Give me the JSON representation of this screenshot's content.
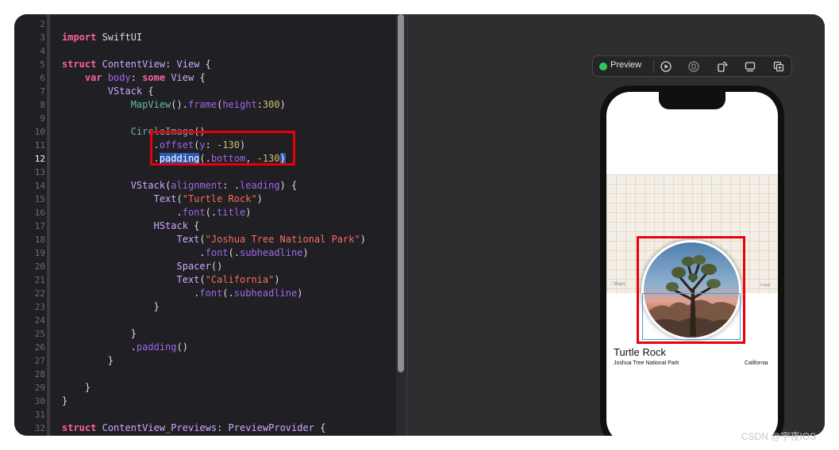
{
  "editor": {
    "current_line": 12,
    "lines": [
      {
        "n": "2",
        "tokens": []
      },
      {
        "n": "3",
        "tokens": [
          {
            "t": "import",
            "c": "kw"
          },
          {
            "t": " SwiftUI",
            "c": ""
          }
        ]
      },
      {
        "n": "4",
        "tokens": []
      },
      {
        "n": "5",
        "tokens": [
          {
            "t": "struct",
            "c": "kw"
          },
          {
            "t": " ",
            "c": ""
          },
          {
            "t": "ContentView",
            "c": "ty"
          },
          {
            "t": ": ",
            "c": ""
          },
          {
            "t": "View",
            "c": "ty"
          },
          {
            "t": " {",
            "c": ""
          }
        ]
      },
      {
        "n": "6",
        "tokens": [
          {
            "t": "    ",
            "c": ""
          },
          {
            "t": "var",
            "c": "kw"
          },
          {
            "t": " ",
            "c": ""
          },
          {
            "t": "body",
            "c": "prop"
          },
          {
            "t": ": ",
            "c": ""
          },
          {
            "t": "some",
            "c": "kw"
          },
          {
            "t": " ",
            "c": ""
          },
          {
            "t": "View",
            "c": "ty"
          },
          {
            "t": " {",
            "c": ""
          }
        ]
      },
      {
        "n": "7",
        "tokens": [
          {
            "t": "        ",
            "c": ""
          },
          {
            "t": "VStack",
            "c": "ty"
          },
          {
            "t": " {",
            "c": ""
          }
        ]
      },
      {
        "n": "8",
        "tokens": [
          {
            "t": "            ",
            "c": ""
          },
          {
            "t": "MapView",
            "c": "fn"
          },
          {
            "t": "().",
            "c": ""
          },
          {
            "t": "frame",
            "c": "prop"
          },
          {
            "t": "(",
            "c": ""
          },
          {
            "t": "height",
            "c": "prop"
          },
          {
            "t": ":",
            "c": ""
          },
          {
            "t": "300",
            "c": "num"
          },
          {
            "t": ")",
            "c": ""
          }
        ]
      },
      {
        "n": "9",
        "tokens": []
      },
      {
        "n": "10",
        "tokens": [
          {
            "t": "            ",
            "c": ""
          },
          {
            "t": "CircleImage",
            "c": "fn"
          },
          {
            "t": "()",
            "c": ""
          }
        ]
      },
      {
        "n": "11",
        "tokens": [
          {
            "t": "                .",
            "c": ""
          },
          {
            "t": "offset",
            "c": "prop"
          },
          {
            "t": "(",
            "c": ""
          },
          {
            "t": "y",
            "c": "prop"
          },
          {
            "t": ": ",
            "c": ""
          },
          {
            "t": "-130",
            "c": "num"
          },
          {
            "t": ")",
            "c": ""
          }
        ]
      },
      {
        "n": "12",
        "tokens": [
          {
            "t": "                .",
            "c": ""
          },
          {
            "t": "padding",
            "c": "sel"
          },
          {
            "t": "(.",
            "c": "underline"
          },
          {
            "t": "bottom",
            "c": "prop underline"
          },
          {
            "t": ", ",
            "c": "underline"
          },
          {
            "t": "-130",
            "c": "num underline"
          },
          {
            "t": ")",
            "c": "sel"
          }
        ]
      },
      {
        "n": "13",
        "tokens": []
      },
      {
        "n": "14",
        "tokens": [
          {
            "t": "            ",
            "c": ""
          },
          {
            "t": "VStack",
            "c": "ty"
          },
          {
            "t": "(",
            "c": ""
          },
          {
            "t": "alignment",
            "c": "prop"
          },
          {
            "t": ": .",
            "c": ""
          },
          {
            "t": "leading",
            "c": "prop"
          },
          {
            "t": ") {",
            "c": ""
          }
        ]
      },
      {
        "n": "15",
        "tokens": [
          {
            "t": "                ",
            "c": ""
          },
          {
            "t": "Text",
            "c": "ty"
          },
          {
            "t": "(",
            "c": ""
          },
          {
            "t": "\"Turtle Rock\"",
            "c": "str"
          },
          {
            "t": ")",
            "c": ""
          }
        ]
      },
      {
        "n": "16",
        "tokens": [
          {
            "t": "                    .",
            "c": ""
          },
          {
            "t": "font",
            "c": "prop"
          },
          {
            "t": "(.",
            "c": ""
          },
          {
            "t": "title",
            "c": "prop"
          },
          {
            "t": ")",
            "c": ""
          }
        ]
      },
      {
        "n": "17",
        "tokens": [
          {
            "t": "                ",
            "c": ""
          },
          {
            "t": "HStack",
            "c": "ty"
          },
          {
            "t": " {",
            "c": ""
          }
        ]
      },
      {
        "n": "18",
        "tokens": [
          {
            "t": "                    ",
            "c": ""
          },
          {
            "t": "Text",
            "c": "ty"
          },
          {
            "t": "(",
            "c": ""
          },
          {
            "t": "\"Joshua Tree National Park\"",
            "c": "str"
          },
          {
            "t": ")",
            "c": ""
          }
        ]
      },
      {
        "n": "19",
        "tokens": [
          {
            "t": "                        .",
            "c": ""
          },
          {
            "t": "font",
            "c": "prop"
          },
          {
            "t": "(.",
            "c": ""
          },
          {
            "t": "subheadline",
            "c": "prop"
          },
          {
            "t": ")",
            "c": ""
          }
        ]
      },
      {
        "n": "20",
        "tokens": [
          {
            "t": "                    ",
            "c": ""
          },
          {
            "t": "Spacer",
            "c": "ty"
          },
          {
            "t": "()",
            "c": ""
          }
        ]
      },
      {
        "n": "21",
        "tokens": [
          {
            "t": "                    ",
            "c": ""
          },
          {
            "t": "Text",
            "c": "ty"
          },
          {
            "t": "(",
            "c": ""
          },
          {
            "t": "\"California\"",
            "c": "str"
          },
          {
            "t": ")",
            "c": ""
          }
        ]
      },
      {
        "n": "22",
        "tokens": [
          {
            "t": "                       .",
            "c": ""
          },
          {
            "t": "font",
            "c": "prop"
          },
          {
            "t": "(.",
            "c": ""
          },
          {
            "t": "subheadline",
            "c": "prop"
          },
          {
            "t": ")",
            "c": ""
          }
        ]
      },
      {
        "n": "23",
        "tokens": [
          {
            "t": "                ",
            "c": ""
          },
          {
            "t": "}",
            "c": ""
          }
        ]
      },
      {
        "n": "24",
        "tokens": []
      },
      {
        "n": "25",
        "tokens": [
          {
            "t": "            ",
            "c": ""
          },
          {
            "t": "}",
            "c": ""
          }
        ]
      },
      {
        "n": "26",
        "tokens": [
          {
            "t": "            .",
            "c": ""
          },
          {
            "t": "padding",
            "c": "prop"
          },
          {
            "t": "()",
            "c": ""
          }
        ]
      },
      {
        "n": "27",
        "tokens": [
          {
            "t": "        ",
            "c": ""
          },
          {
            "t": "}",
            "c": ""
          }
        ]
      },
      {
        "n": "28",
        "tokens": []
      },
      {
        "n": "29",
        "tokens": [
          {
            "t": "    ",
            "c": ""
          },
          {
            "t": "}",
            "c": ""
          }
        ]
      },
      {
        "n": "30",
        "tokens": [
          {
            "t": "}",
            "c": ""
          }
        ]
      },
      {
        "n": "31",
        "tokens": []
      },
      {
        "n": "32",
        "tokens": [
          {
            "t": "struct",
            "c": "kw"
          },
          {
            "t": " ",
            "c": ""
          },
          {
            "t": "ContentView_Previews",
            "c": "ty"
          },
          {
            "t": ": ",
            "c": ""
          },
          {
            "t": "PreviewProvider",
            "c": "ty"
          },
          {
            "t": " {",
            "c": ""
          }
        ]
      }
    ]
  },
  "preview_bar": {
    "label": "Preview",
    "status_color": "#31c75a",
    "icons": [
      "live-play-icon",
      "selectable-icon",
      "rotate-device-icon",
      "device-settings-icon",
      "duplicate-preview-icon"
    ]
  },
  "device": {
    "map_logo": "Maps",
    "map_legal": "Legal",
    "title": "Turtle Rock",
    "park": "Joshua Tree National Park",
    "state": "California"
  },
  "watermark": "CSDN @宇夜IOS",
  "colors": {
    "highlight_box": "#e8000b",
    "selection_frame": "#3d9ee8",
    "editor_bg": "#1f1f24",
    "canvas_bg": "#2e2e30"
  }
}
